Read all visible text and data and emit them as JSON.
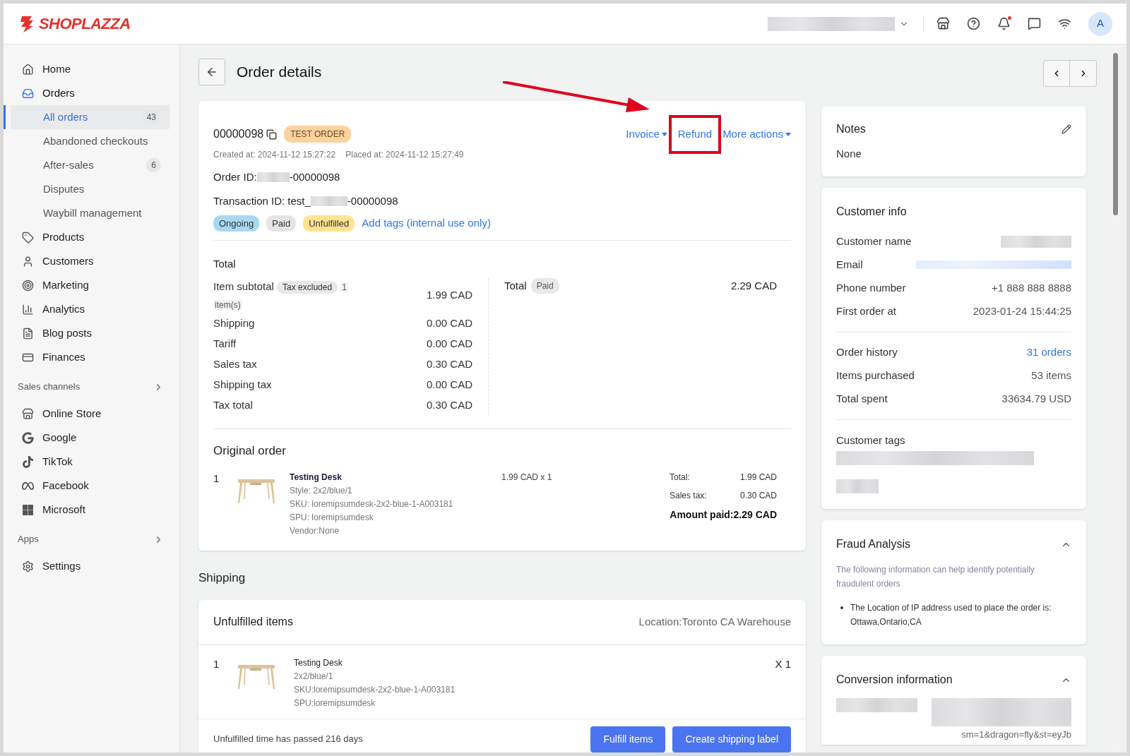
{
  "brand": {
    "name": "SHOPLAZZA"
  },
  "header": {
    "avatar": "A",
    "notification": true
  },
  "sidebar": {
    "entries": [
      {
        "kind": "nav",
        "label": "Home",
        "selected": false
      },
      {
        "kind": "nav",
        "label": "Orders",
        "selected": true,
        "children": [
          {
            "label": "All orders",
            "badge": "43",
            "selected": true
          },
          {
            "label": "Abandoned checkouts",
            "selected": false
          },
          {
            "label": "After-sales",
            "badge": "6",
            "selected": false
          },
          {
            "label": "Disputes",
            "selected": false
          },
          {
            "label": "Waybill management",
            "selected": false
          }
        ]
      },
      {
        "kind": "nav",
        "label": "Products",
        "selected": false
      },
      {
        "kind": "nav",
        "label": "Customers",
        "selected": false
      },
      {
        "kind": "nav",
        "label": "Marketing",
        "selected": false
      },
      {
        "kind": "nav",
        "label": "Analytics",
        "selected": false
      },
      {
        "kind": "nav",
        "label": "Blog posts",
        "selected": false
      },
      {
        "kind": "nav",
        "label": "Finances",
        "selected": false
      },
      {
        "kind": "section",
        "label": "Sales channels"
      },
      {
        "kind": "nav",
        "label": "Online Store",
        "selected": false
      },
      {
        "kind": "nav",
        "label": "Google",
        "selected": false
      },
      {
        "kind": "nav",
        "label": "TikTok",
        "selected": false
      },
      {
        "kind": "nav",
        "label": "Facebook",
        "selected": false
      },
      {
        "kind": "nav",
        "label": "Microsoft",
        "selected": false
      },
      {
        "kind": "section",
        "label": "Apps"
      },
      {
        "kind": "nav",
        "label": "Settings",
        "selected": false
      }
    ]
  },
  "page": {
    "title": "Order details"
  },
  "order": {
    "number": "00000098",
    "badge": "TEST ORDER",
    "actions": [
      {
        "label": "Invoice",
        "dropdown": true,
        "highlighted": false
      },
      {
        "label": "Refund",
        "dropdown": false,
        "highlighted": true
      },
      {
        "label": "More actions",
        "dropdown": true,
        "highlighted": false
      }
    ],
    "dates": [
      {
        "label": "Created at:",
        "value": "2024-11-12 15:27:22"
      },
      {
        "label": "Placed at:",
        "value": "2024-11-12 15:27:49"
      }
    ],
    "order_id": {
      "label": "Order ID:",
      "value": "-00000098"
    },
    "transaction_id": {
      "label": "Transaction ID: test_",
      "value": "-00000098"
    },
    "tags": [
      {
        "label": "Ongoing",
        "color": "#a8d9f2"
      },
      {
        "label": "Paid",
        "color": "#e4e5e7"
      },
      {
        "label": "Unfulfilled",
        "color": "#ffe38f"
      }
    ],
    "add_tags": "Add tags (internal use only)"
  },
  "total": {
    "title": "Total",
    "subtotal": {
      "label": "Item subtotal",
      "badge": "Tax excluded",
      "count": "1 item(s)",
      "value": "1.99 CAD"
    },
    "rows": [
      {
        "label": "Shipping",
        "value": "0.00 CAD"
      },
      {
        "label": "Tariff",
        "value": "0.00 CAD"
      },
      {
        "label": "Sales tax",
        "value": "0.30 CAD"
      },
      {
        "label": "Shipping tax",
        "value": "0.00 CAD"
      },
      {
        "label": "Tax total",
        "value": "0.30 CAD"
      }
    ],
    "grand": {
      "label": "Total",
      "badge": "Paid",
      "value": "2.29 CAD"
    }
  },
  "original_order": {
    "title": "Original order",
    "items": [
      {
        "qty": "1",
        "name": "Testing Desk",
        "lines": [
          "Style: 2x2/blue/1",
          "SKU: loremipsumdesk-2x2-blue-1-A003181",
          "SPU: loremipsumdesk",
          "Vendor:None"
        ],
        "price": "1.99 CAD x 1",
        "summary": [
          {
            "label": "Total:",
            "value": "1.99 CAD"
          },
          {
            "label": "Sales tax:",
            "value": "0.30 CAD"
          }
        ],
        "amount_paid": "Amount paid:2.29 CAD"
      }
    ]
  },
  "shipping": {
    "title": "Shipping",
    "card_title": "Unfulfilled items",
    "location": "Location:Toronto CA Warehouse",
    "items": [
      {
        "qty": "1",
        "name": "Testing Desk",
        "lines": [
          "2x2/blue/1",
          "SKU:loremipsumdesk-2x2-blue-1-A003181",
          "SPU:loremipsumdesk"
        ],
        "quantity": "X 1"
      }
    ],
    "footer": "Unfulfilled time has passed 216 days",
    "buttons": [
      "Fulfill items",
      "Create shipping label"
    ]
  },
  "notes": {
    "title": "Notes",
    "text": "None"
  },
  "customer": {
    "title": "Customer info",
    "groups": [
      [
        {
          "label": "Customer name",
          "kind": "redacted"
        },
        {
          "label": "Email",
          "kind": "redacted_link"
        },
        {
          "label": "Phone number",
          "kind": "text",
          "value": "+1 888 888 8888"
        },
        {
          "label": "First order at",
          "kind": "text",
          "value": "2023-01-24 15:44:25"
        }
      ],
      [
        {
          "label": "Order history",
          "kind": "link",
          "value": "31 orders"
        },
        {
          "label": "Items purchased",
          "kind": "text",
          "value": "53 items"
        },
        {
          "label": "Total spent",
          "kind": "text",
          "value": "33634.79 USD"
        }
      ]
    ],
    "tags_label": "Customer tags"
  },
  "fraud": {
    "title": "Fraud Analysis",
    "expanded": true,
    "description": "The following information can help identify potentially fraudulent orders",
    "bullets": [
      "The Location of IP address used to place the order is: Ottawa,Ontario,CA"
    ]
  },
  "conversion": {
    "title": "Conversion information",
    "expanded": true,
    "text": "sm=1&dragon=fly&st=eyJb"
  }
}
